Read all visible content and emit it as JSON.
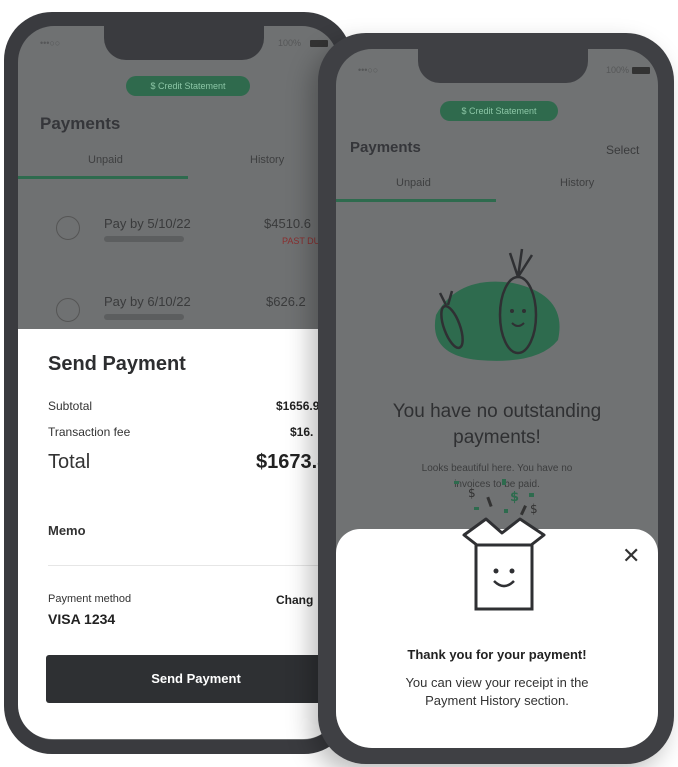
{
  "left_screen": {
    "status_left": "•••○○ ",
    "status_right": "100%",
    "credit_pill": "$ Credit Statement",
    "title": "Payments",
    "tabs": [
      "Unpaid",
      "History"
    ],
    "rows": [
      {
        "due": "Pay by 5/10/22",
        "sub": "",
        "amount": "$4510.6",
        "note": "PAST DU"
      },
      {
        "due": "Pay by 6/10/22",
        "sub": "",
        "amount": "$626.2"
      }
    ],
    "sheet": {
      "heading": "Send Payment",
      "subtotal_label": "Subtotal",
      "subtotal_value": "$1656.9",
      "fee_label": "Transaction fee",
      "fee_value": "$16.",
      "total_label": "Total",
      "total_value": "$1673.8",
      "memo_label": "Memo",
      "method_label": "Payment method",
      "method_value": "VISA 1234",
      "change_label": "Chang",
      "send_button": "Send Payment"
    }
  },
  "right_screen": {
    "status_left": "•••○○ ",
    "status_right": "100%",
    "credit_pill": "$ Credit Statement",
    "title": "Payments",
    "select": "Select",
    "tabs": [
      "Unpaid",
      "History"
    ],
    "empty_heading_1": "You have no outstanding",
    "empty_heading_2": "payments!",
    "empty_sub_1": "Looks beautiful here. You have no",
    "empty_sub_2": "invoices to be paid.",
    "modal": {
      "heading": "Thank you for your payment!",
      "line1": "You can view your receipt in the",
      "line2": "Payment History section."
    }
  },
  "colors": {
    "accent": "#2e6b4e",
    "button": "#2e3033",
    "overlay": "#707273"
  }
}
